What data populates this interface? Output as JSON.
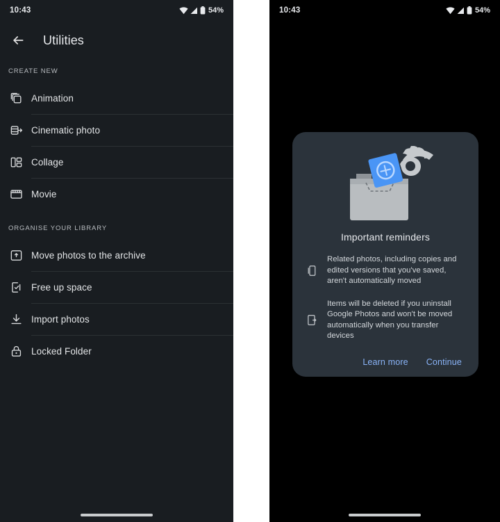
{
  "colors": {
    "left_bg": "#191d21",
    "right_bg": "#000000",
    "card_bg": "#2b333b",
    "accent": "#8ab4f8",
    "divider": "#2c3134",
    "text_primary": "#e8eaed",
    "text_secondary": "#d4d8dc"
  },
  "status_bar": {
    "time": "10:43",
    "battery_percent": "54%",
    "icons": [
      "wifi-icon",
      "signal-icon",
      "battery-icon"
    ]
  },
  "left_screen": {
    "appbar": {
      "back_icon": "back-arrow-icon",
      "title": "Utilities"
    },
    "sections": [
      {
        "header": "CREATE NEW",
        "items": [
          {
            "label": "Animation",
            "icon": "animation-icon"
          },
          {
            "label": "Cinematic photo",
            "icon": "cinematic-photo-icon"
          },
          {
            "label": "Collage",
            "icon": "collage-icon"
          },
          {
            "label": "Movie",
            "icon": "movie-icon"
          }
        ]
      },
      {
        "header": "ORGANISE YOUR LIBRARY",
        "items": [
          {
            "label": "Move photos to the archive",
            "icon": "archive-icon"
          },
          {
            "label": "Free up space",
            "icon": "free-up-space-icon"
          },
          {
            "label": "Import photos",
            "icon": "import-download-icon"
          },
          {
            "label": "Locked Folder",
            "icon": "lock-icon"
          }
        ]
      }
    ]
  },
  "right_screen": {
    "dialog": {
      "illustration": "hand-placing-photo-in-folder-illustration",
      "title": "Important reminders",
      "reminders": [
        {
          "icon": "phone-copies-icon",
          "text": "Related photos, including copies and edited versions that you've saved, aren't automatically moved"
        },
        {
          "icon": "phone-uninstall-icon",
          "text": "Items will be deleted if you uninstall Google Photos and won't be moved automatically when you transfer devices"
        }
      ],
      "actions": {
        "learn_more": "Learn more",
        "continue": "Continue"
      }
    }
  },
  "gesture_bar": {
    "name": "home-gesture-pill"
  }
}
